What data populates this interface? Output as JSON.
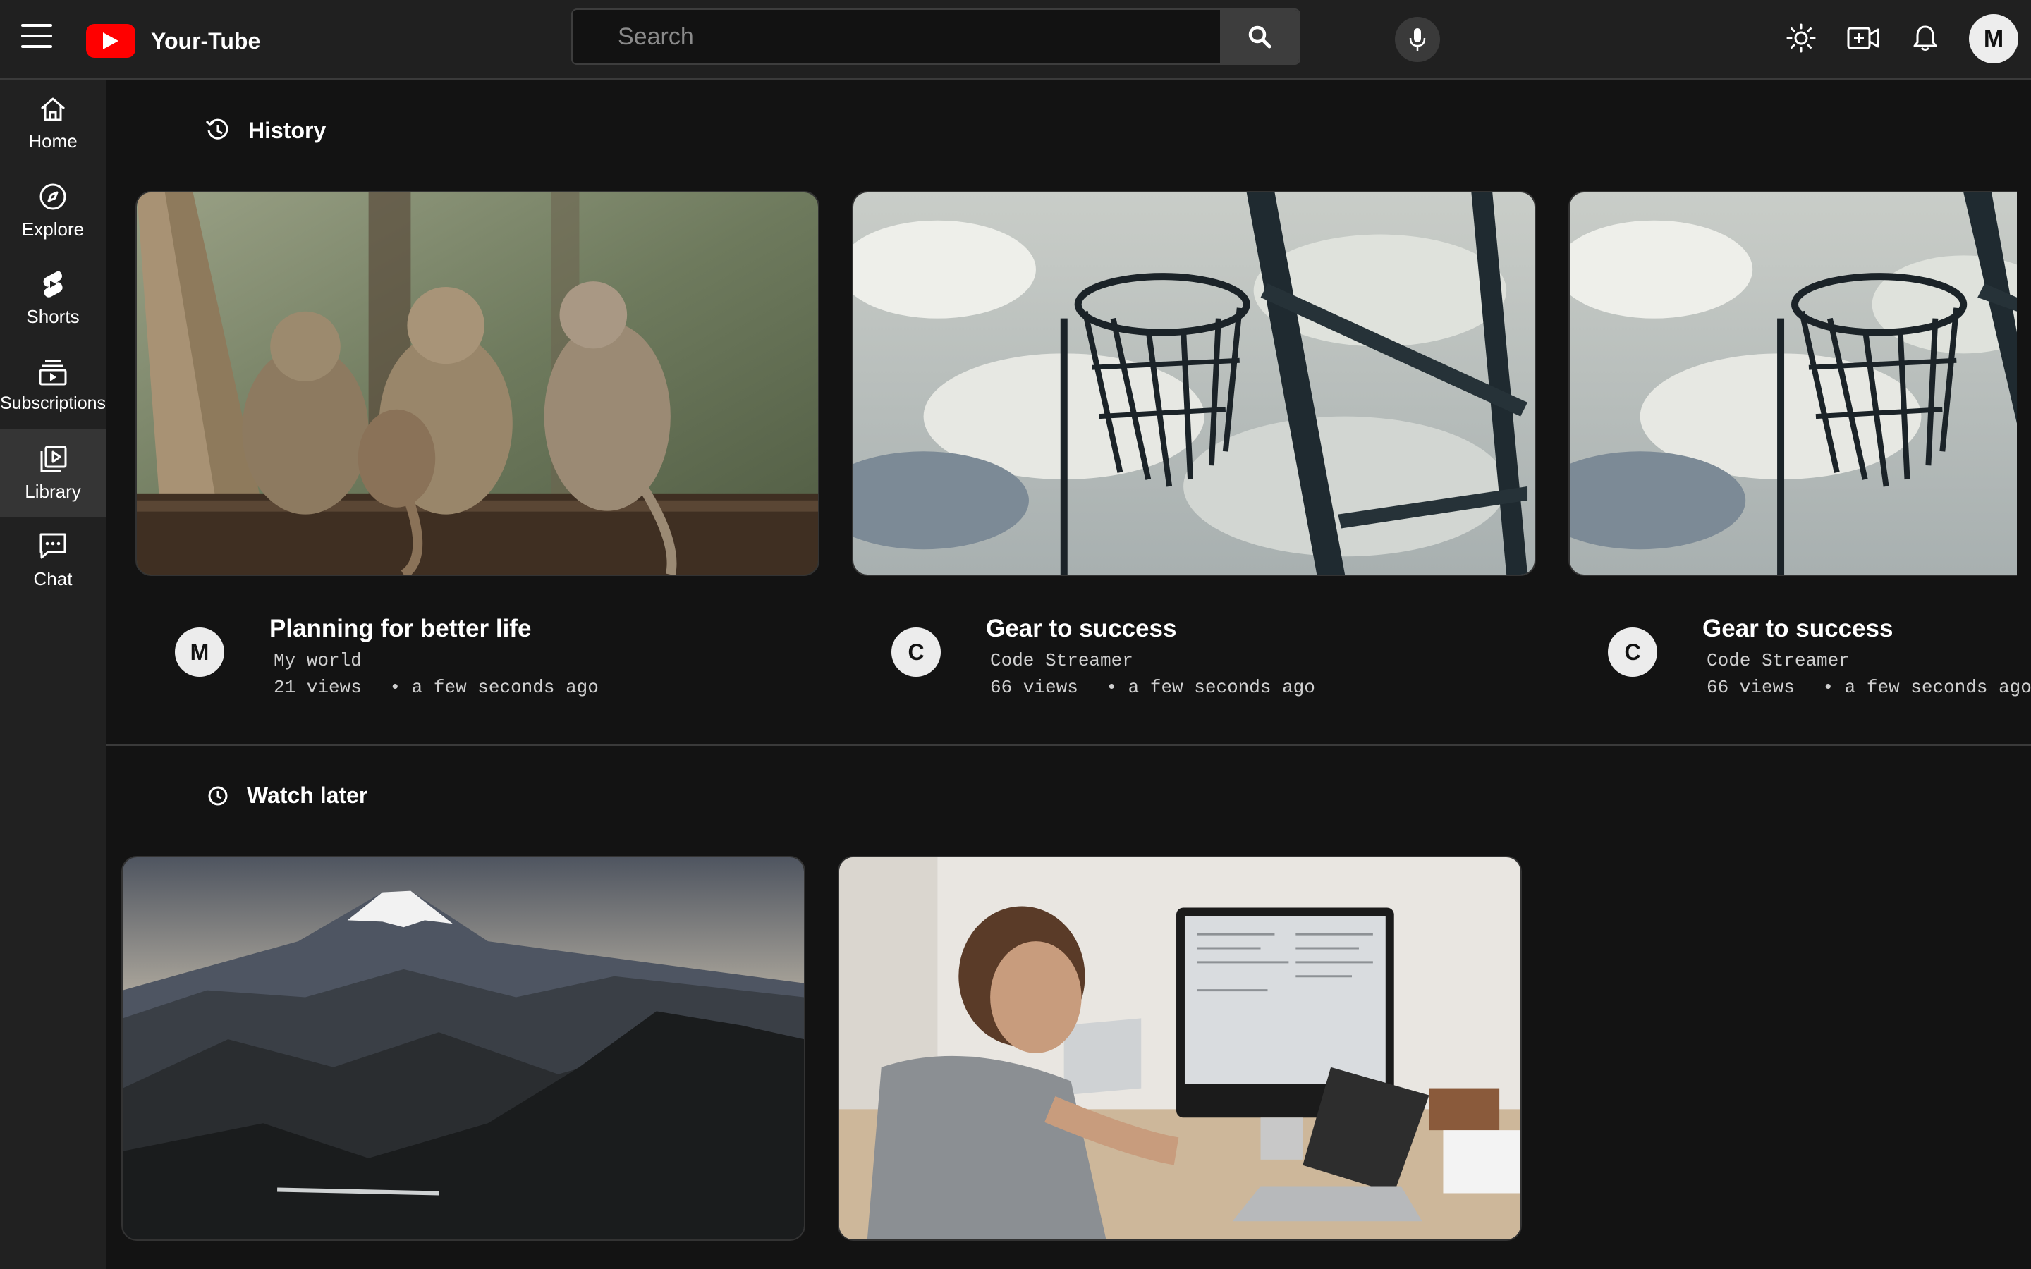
{
  "header": {
    "app_name": "Your-Tube",
    "search_placeholder": "Search",
    "avatar_initial": "M",
    "icons": [
      "menu-icon",
      "search-icon",
      "mic-icon",
      "theme-sun-icon",
      "video-upload-icon",
      "bell-icon"
    ],
    "brand_color": "#ff0000"
  },
  "sidebar": {
    "items": [
      {
        "label": "Home",
        "icon": "home-icon"
      },
      {
        "label": "Explore",
        "icon": "compass-icon"
      },
      {
        "label": "Shorts",
        "icon": "shorts-icon"
      },
      {
        "label": "Subscriptions",
        "icon": "subscriptions-icon"
      },
      {
        "label": "Library",
        "icon": "library-icon",
        "active": true
      },
      {
        "label": "Chat",
        "icon": "chat-icon"
      }
    ]
  },
  "history": {
    "title": "History",
    "videos": [
      {
        "title": "Planning for better life",
        "channel": "My world",
        "initial": "M",
        "views": "21 views",
        "time": "• a few seconds ago"
      },
      {
        "title": "Gear to success",
        "channel": "Code Streamer",
        "initial": "C",
        "views": "66 views",
        "time": "• a few seconds ago"
      },
      {
        "title": "Gear to success",
        "channel": "Code Streamer",
        "initial": "C",
        "views": "66 views",
        "time": "• a few seconds ago"
      }
    ]
  },
  "watch_later": {
    "title": "Watch later"
  }
}
